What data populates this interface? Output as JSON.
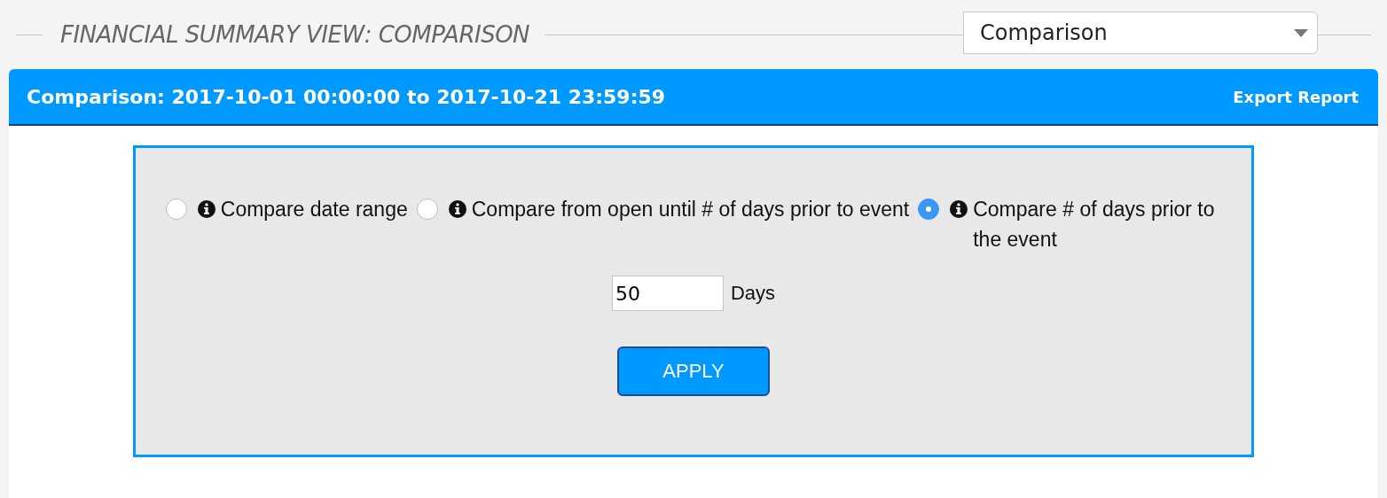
{
  "page_title": "FINANCIAL SUMMARY VIEW: COMPARISON",
  "view_select": {
    "value": "Comparison"
  },
  "header": {
    "title": "Comparison: 2017-10-01 00:00:00 to 2017-10-21 23:59:59",
    "export_link": "Export Report"
  },
  "options": [
    {
      "label": "Compare date range",
      "selected": false
    },
    {
      "label": "Compare from open until # of days prior to event",
      "selected": false
    },
    {
      "label": "Compare # of days prior to the event",
      "selected": true
    }
  ],
  "days_field": {
    "value": "50",
    "unit": "Days"
  },
  "apply_button": "APPLY"
}
